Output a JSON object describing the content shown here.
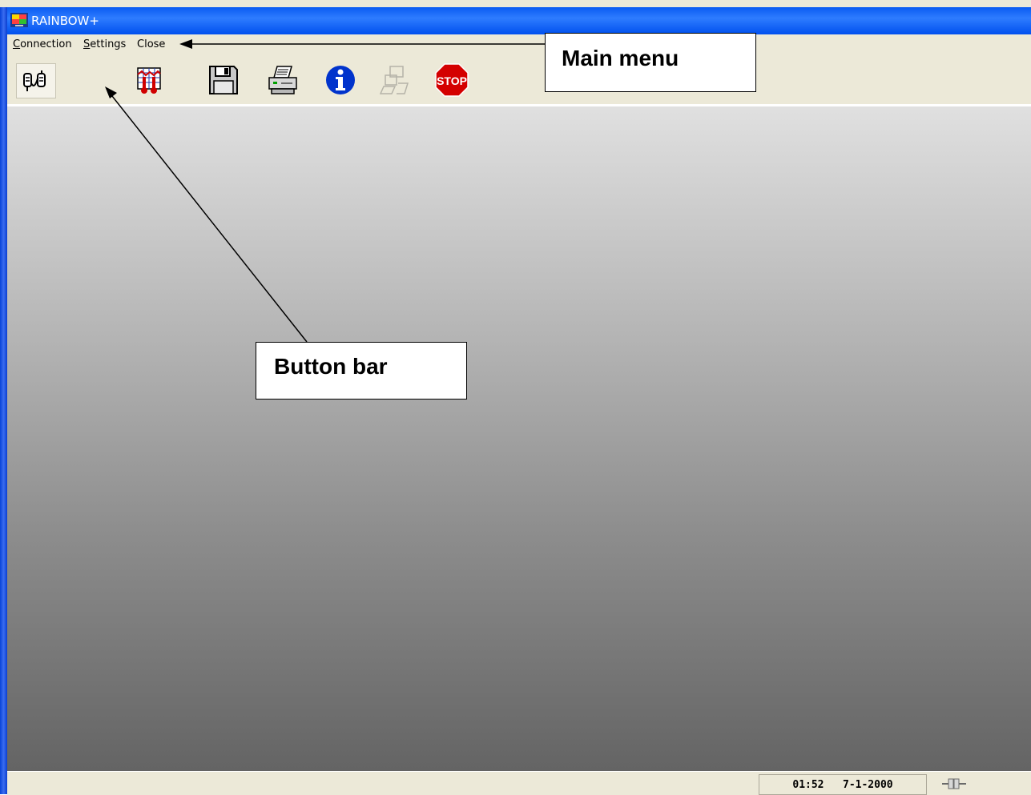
{
  "window": {
    "title": "RAINBOW+"
  },
  "menu": [
    {
      "label": "Connection",
      "underline": "C",
      "rest": "onnection"
    },
    {
      "label": "Settings",
      "underline": "S",
      "rest": "ettings"
    },
    {
      "label": "Close",
      "underline": "",
      "rest": "Close"
    }
  ],
  "toolbar": {
    "buttons": [
      {
        "name": "connection-icon",
        "state": "pressed"
      },
      {
        "name": "temperature-chart-icon",
        "state": "enabled"
      },
      {
        "name": "floppy-disk-icon",
        "state": "enabled"
      },
      {
        "name": "printer-icon",
        "state": "enabled"
      },
      {
        "name": "info-icon",
        "state": "enabled"
      },
      {
        "name": "computer-disabled-icon",
        "state": "disabled"
      },
      {
        "name": "stop-icon",
        "state": "enabled",
        "label": "STOP"
      }
    ]
  },
  "status": {
    "time": "01:52",
    "date": "7-1-2000"
  },
  "annotations": {
    "main_menu": "Main menu",
    "button_bar": "Button bar"
  },
  "colors": {
    "titlebar": "#0a5bf2",
    "stop_red": "#d40000",
    "info_blue": "#0033cc"
  }
}
